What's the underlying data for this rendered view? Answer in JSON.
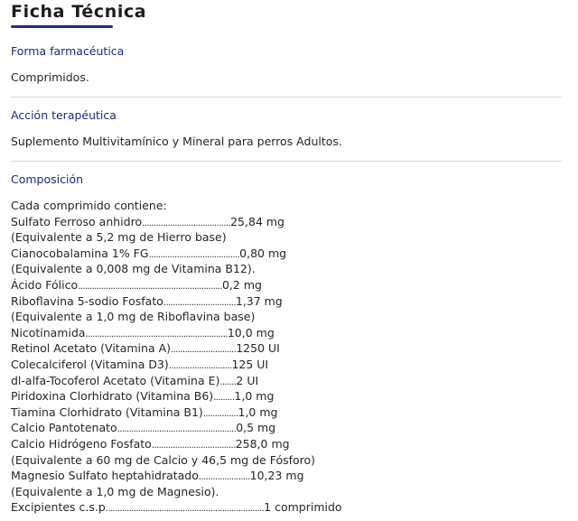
{
  "title": "Ficha Técnica",
  "forma": {
    "heading": "Forma farmacéutica",
    "text": "Comprimidos."
  },
  "accion": {
    "heading": "Acción terapéutica",
    "text": "Suplemento Multivitamínico y Mineral para perros Adultos."
  },
  "composicion": {
    "heading": "Composición",
    "intro": "Cada comprimido contiene:",
    "lines": [
      {
        "name": "Sulfato Ferroso anhidro",
        "dots": "......................................",
        "value": "25,84 mg"
      },
      {
        "name": "(Equivalente a 5,2 mg de Hierro base)",
        "dots": "",
        "value": ""
      },
      {
        "name": "Cianocobalamina 1% FG",
        "dots": ".......................................",
        "value": "0,80 mg"
      },
      {
        "name": "(Equivalente a 0,008 mg de Vitamina B12).",
        "dots": "",
        "value": ""
      },
      {
        "name": "Ácido Fólico",
        "dots": "..............................................................",
        "value": "0,2 mg"
      },
      {
        "name": "Riboflavina 5-sodio Fosfato",
        "dots": "...............................",
        "value": "1,37 mg"
      },
      {
        "name": "(Equivalente a 1,0 mg de Riboflavina base)",
        "dots": "",
        "value": ""
      },
      {
        "name": "Nicotinamida",
        "dots": ".............................................................",
        "value": "10,0 mg"
      },
      {
        "name": "Retinol Acetato (Vitamina A)",
        "dots": "............................",
        "value": "1250 UI"
      },
      {
        "name": "Colecalciferol (Vitamina D3)",
        "dots": "...........................",
        "value": "125 UI"
      },
      {
        "name": "dl-alfa-Tocoferol Acetato (Vitamina E)",
        "dots": ".......",
        "value": "2 UI"
      },
      {
        "name": "Piridoxina Clorhidrato (Vitamina B6)",
        "dots": ".........",
        "value": "1,0 mg"
      },
      {
        "name": "Tiamina Clorhidrato (Vitamina B1)",
        "dots": "...............",
        "value": "1,0 mg"
      },
      {
        "name": "Calcio Pantotenato",
        "dots": "...................................................",
        "value": "0,5 mg"
      },
      {
        "name": "Calcio Hidrógeno Fosfato",
        "dots": "....................................",
        "value": "258,0 mg"
      },
      {
        "name": "(Equivalente a 60 mg de Calcio y 46,5 mg de Fósforo)",
        "dots": "",
        "value": ""
      },
      {
        "name": "Magnesio Sulfato heptahidratado",
        "dots": "......................",
        "value": "10,23 mg"
      },
      {
        "name": "(Equivalente a 1,0 mg de Magnesio).",
        "dots": "",
        "value": ""
      },
      {
        "name": "Excipientes c.s.p",
        "dots": "....................................................................",
        "value": "1 comprimido"
      }
    ]
  }
}
